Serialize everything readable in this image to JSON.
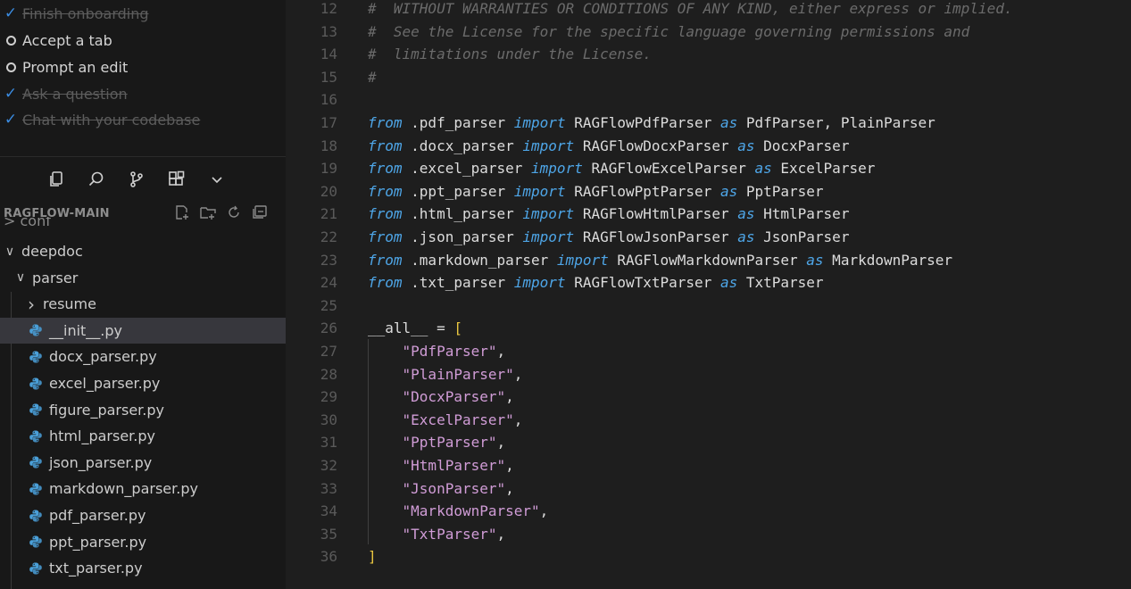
{
  "checklist": [
    {
      "label": "Finish onboarding",
      "done": true
    },
    {
      "label": "Accept a tab",
      "done": false
    },
    {
      "label": "Prompt an edit",
      "done": false
    },
    {
      "label": "Ask a question",
      "done": true
    },
    {
      "label": "Chat with your codebase",
      "done": true
    }
  ],
  "activity_icons": [
    "files-icon",
    "search-icon",
    "source-control-icon",
    "extensions-icon",
    "chevron-down-icon"
  ],
  "explorer": {
    "title": "RAGFLOW-MAIN",
    "clipped_folder": "conf",
    "actions": [
      "new-file-icon",
      "new-folder-icon",
      "refresh-icon",
      "collapse-all-icon"
    ],
    "items": [
      {
        "label": "deepdoc",
        "kind": "folder-open",
        "depth": 0
      },
      {
        "label": "parser",
        "kind": "folder-open",
        "depth": 1
      },
      {
        "label": "resume",
        "kind": "folder-closed",
        "depth": 2
      },
      {
        "label": "__init__.py",
        "kind": "python-file",
        "depth": 2,
        "selected": true
      },
      {
        "label": "docx_parser.py",
        "kind": "python-file",
        "depth": 2
      },
      {
        "label": "excel_parser.py",
        "kind": "python-file",
        "depth": 2
      },
      {
        "label": "figure_parser.py",
        "kind": "python-file",
        "depth": 2
      },
      {
        "label": "html_parser.py",
        "kind": "python-file",
        "depth": 2
      },
      {
        "label": "json_parser.py",
        "kind": "python-file",
        "depth": 2
      },
      {
        "label": "markdown_parser.py",
        "kind": "python-file",
        "depth": 2
      },
      {
        "label": "pdf_parser.py",
        "kind": "python-file",
        "depth": 2
      },
      {
        "label": "ppt_parser.py",
        "kind": "python-file",
        "depth": 2
      },
      {
        "label": "txt_parser.py",
        "kind": "python-file",
        "depth": 2
      }
    ]
  },
  "editor": {
    "lines": [
      {
        "n": "12",
        "tokens": [
          {
            "t": "#  WITHOUT WARRANTIES OR CONDITIONS OF ANY KIND, either express or implied.",
            "c": "cmt"
          }
        ]
      },
      {
        "n": "13",
        "tokens": [
          {
            "t": "#  See the License for the specific language governing permissions and",
            "c": "cmt"
          }
        ]
      },
      {
        "n": "14",
        "tokens": [
          {
            "t": "#  limitations under the License.",
            "c": "cmt"
          }
        ]
      },
      {
        "n": "15",
        "tokens": [
          {
            "t": "#",
            "c": "cmt"
          }
        ]
      },
      {
        "n": "16",
        "tokens": []
      },
      {
        "n": "17",
        "tokens": [
          {
            "t": "from",
            "c": "kw"
          },
          {
            "t": " .pdf_parser ",
            "c": "id"
          },
          {
            "t": "import",
            "c": "kw"
          },
          {
            "t": " RAGFlowPdfParser ",
            "c": "id"
          },
          {
            "t": "as",
            "c": "kw"
          },
          {
            "t": " PdfParser, PlainParser",
            "c": "id"
          }
        ]
      },
      {
        "n": "18",
        "tokens": [
          {
            "t": "from",
            "c": "kw"
          },
          {
            "t": " .docx_parser ",
            "c": "id"
          },
          {
            "t": "import",
            "c": "kw"
          },
          {
            "t": " RAGFlowDocxParser ",
            "c": "id"
          },
          {
            "t": "as",
            "c": "kw"
          },
          {
            "t": " DocxParser",
            "c": "id"
          }
        ]
      },
      {
        "n": "19",
        "tokens": [
          {
            "t": "from",
            "c": "kw"
          },
          {
            "t": " .excel_parser ",
            "c": "id"
          },
          {
            "t": "import",
            "c": "kw"
          },
          {
            "t": " RAGFlowExcelParser ",
            "c": "id"
          },
          {
            "t": "as",
            "c": "kw"
          },
          {
            "t": " ExcelParser",
            "c": "id"
          }
        ]
      },
      {
        "n": "20",
        "tokens": [
          {
            "t": "from",
            "c": "kw"
          },
          {
            "t": " .ppt_parser ",
            "c": "id"
          },
          {
            "t": "import",
            "c": "kw"
          },
          {
            "t": " RAGFlowPptParser ",
            "c": "id"
          },
          {
            "t": "as",
            "c": "kw"
          },
          {
            "t": " PptParser",
            "c": "id"
          }
        ]
      },
      {
        "n": "21",
        "tokens": [
          {
            "t": "from",
            "c": "kw"
          },
          {
            "t": " .html_parser ",
            "c": "id"
          },
          {
            "t": "import",
            "c": "kw"
          },
          {
            "t": " RAGFlowHtmlParser ",
            "c": "id"
          },
          {
            "t": "as",
            "c": "kw"
          },
          {
            "t": " HtmlParser",
            "c": "id"
          }
        ]
      },
      {
        "n": "22",
        "tokens": [
          {
            "t": "from",
            "c": "kw"
          },
          {
            "t": " .json_parser ",
            "c": "id"
          },
          {
            "t": "import",
            "c": "kw"
          },
          {
            "t": " RAGFlowJsonParser ",
            "c": "id"
          },
          {
            "t": "as",
            "c": "kw"
          },
          {
            "t": " JsonParser",
            "c": "id"
          }
        ]
      },
      {
        "n": "23",
        "tokens": [
          {
            "t": "from",
            "c": "kw"
          },
          {
            "t": " .markdown_parser ",
            "c": "id"
          },
          {
            "t": "import",
            "c": "kw"
          },
          {
            "t": " RAGFlowMarkdownParser ",
            "c": "id"
          },
          {
            "t": "as",
            "c": "kw"
          },
          {
            "t": " MarkdownParser",
            "c": "id"
          }
        ]
      },
      {
        "n": "24",
        "tokens": [
          {
            "t": "from",
            "c": "kw"
          },
          {
            "t": " .txt_parser ",
            "c": "id"
          },
          {
            "t": "import",
            "c": "kw"
          },
          {
            "t": " RAGFlowTxtParser ",
            "c": "id"
          },
          {
            "t": "as",
            "c": "kw"
          },
          {
            "t": " TxtParser",
            "c": "id"
          }
        ]
      },
      {
        "n": "25",
        "tokens": []
      },
      {
        "n": "26",
        "tokens": [
          {
            "t": "__all__",
            "c": "id"
          },
          {
            "t": " = ",
            "c": "id"
          },
          {
            "t": "[",
            "c": "brk"
          }
        ]
      },
      {
        "n": "27",
        "tokens": [
          {
            "t": "    ",
            "c": "id"
          },
          {
            "t": "\"PdfParser\"",
            "c": "str"
          },
          {
            "t": ",",
            "c": "id"
          }
        ]
      },
      {
        "n": "28",
        "tokens": [
          {
            "t": "    ",
            "c": "id"
          },
          {
            "t": "\"PlainParser\"",
            "c": "str"
          },
          {
            "t": ",",
            "c": "id"
          }
        ]
      },
      {
        "n": "29",
        "tokens": [
          {
            "t": "    ",
            "c": "id"
          },
          {
            "t": "\"DocxParser\"",
            "c": "str"
          },
          {
            "t": ",",
            "c": "id"
          }
        ]
      },
      {
        "n": "30",
        "tokens": [
          {
            "t": "    ",
            "c": "id"
          },
          {
            "t": "\"ExcelParser\"",
            "c": "str"
          },
          {
            "t": ",",
            "c": "id"
          }
        ]
      },
      {
        "n": "31",
        "tokens": [
          {
            "t": "    ",
            "c": "id"
          },
          {
            "t": "\"PptParser\"",
            "c": "str"
          },
          {
            "t": ",",
            "c": "id"
          }
        ]
      },
      {
        "n": "32",
        "tokens": [
          {
            "t": "    ",
            "c": "id"
          },
          {
            "t": "\"HtmlParser\"",
            "c": "str"
          },
          {
            "t": ",",
            "c": "id"
          }
        ]
      },
      {
        "n": "33",
        "tokens": [
          {
            "t": "    ",
            "c": "id"
          },
          {
            "t": "\"JsonParser\"",
            "c": "str"
          },
          {
            "t": ",",
            "c": "id"
          }
        ]
      },
      {
        "n": "34",
        "tokens": [
          {
            "t": "    ",
            "c": "id"
          },
          {
            "t": "\"MarkdownParser\"",
            "c": "str"
          },
          {
            "t": ",",
            "c": "id"
          }
        ]
      },
      {
        "n": "35",
        "tokens": [
          {
            "t": "    ",
            "c": "id"
          },
          {
            "t": "\"TxtParser\"",
            "c": "str"
          },
          {
            "t": ",",
            "c": "id"
          }
        ]
      },
      {
        "n": "36",
        "tokens": [
          {
            "t": "]",
            "c": "brk"
          }
        ]
      }
    ]
  },
  "colors": {
    "keyword": "#4ea6e8",
    "string": "#d09cd6",
    "bracket": "#e8c540",
    "comment": "#6b6b6b",
    "check": "#3a8be0",
    "python_icon": "#4a9fd8",
    "selection": "#37373d"
  }
}
